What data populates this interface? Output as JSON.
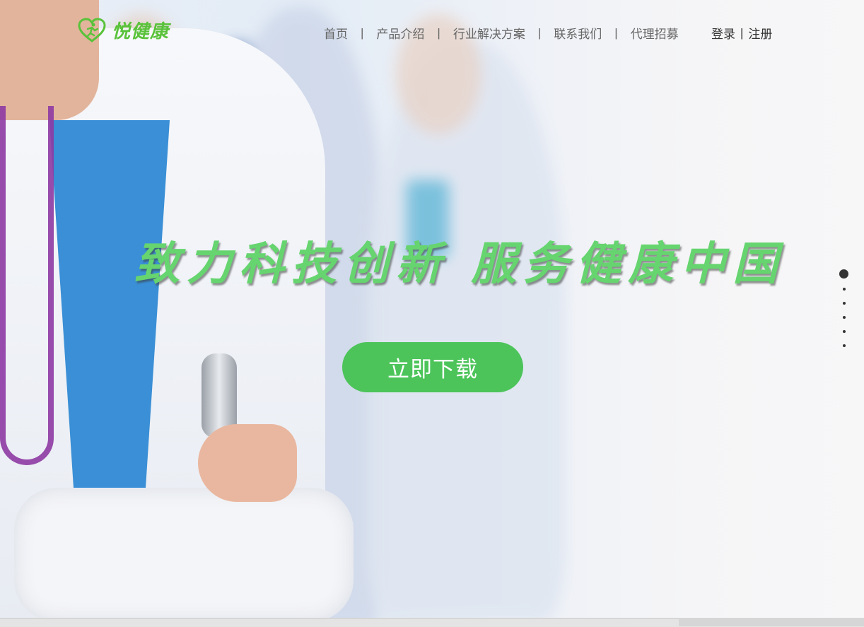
{
  "brand": {
    "name": "悦健康",
    "color": "#59c23a",
    "icon": "heart-runner-icon"
  },
  "nav": {
    "items": [
      {
        "label": "首页"
      },
      {
        "label": "产品介绍"
      },
      {
        "label": "行业解决方案"
      },
      {
        "label": "联系我们"
      },
      {
        "label": "代理招募"
      }
    ],
    "separator": "|"
  },
  "auth": {
    "login": "登录",
    "separator": "|",
    "register": "注册"
  },
  "hero": {
    "slogan": "致力科技创新  服务健康中国",
    "slogan_color": "#66d46f",
    "download_button": "立即下载",
    "button_color": "#4cc45a",
    "background_image": "doctors-team-photo"
  },
  "pager": {
    "total": 6,
    "active_index": 0
  }
}
